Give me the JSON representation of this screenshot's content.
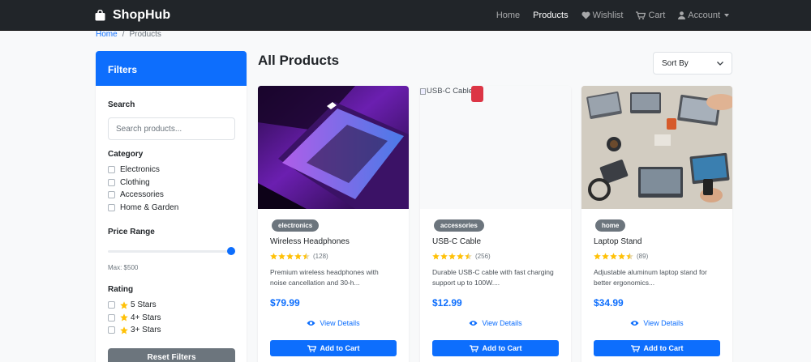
{
  "brand": {
    "name": "ShopHub"
  },
  "nav": {
    "home": "Home",
    "products": "Products",
    "wishlist": "Wishlist",
    "cart": "Cart",
    "account": "Account"
  },
  "breadcrumb": {
    "home": "Home",
    "current": "Products",
    "separator": "/"
  },
  "filters": {
    "title": "Filters",
    "search_label": "Search",
    "search_placeholder": "Search products...",
    "category_label": "Category",
    "categories": [
      "Electronics",
      "Clothing",
      "Accessories",
      "Home & Garden"
    ],
    "price_label": "Price Range",
    "price_max_label": "Max: $500",
    "price_slider_fraction": 1.0,
    "rating_label": "Rating",
    "ratings": [
      "5 Stars",
      "4+ Stars",
      "3+ Stars"
    ],
    "reset_label": "Reset Filters"
  },
  "main": {
    "title": "All Products",
    "sort_label": "Sort By"
  },
  "products": [
    {
      "badge": "electronics",
      "name": "Wireless Headphones",
      "rating": 4.5,
      "reviews": "(128)",
      "desc_line1": "Premium wireless headphones with",
      "desc_line2": "noise cancellation and 30-h...",
      "price": "$79.99",
      "view_label": "View Details",
      "cart_label": "Add to Cart",
      "image": "laptop-purple-light"
    },
    {
      "badge": "accessories",
      "name": "USB-C Cable",
      "rating": 4.5,
      "reviews": "(256)",
      "desc_line1": "Durable USB-C cable with fast charging",
      "desc_line2": "support up to 100W....",
      "price": "$12.99",
      "view_label": "View Details",
      "cart_label": "Add to Cart",
      "image_alt": "USB-C Cable"
    },
    {
      "badge": "home",
      "name": "Laptop Stand",
      "rating": 4.5,
      "reviews": "(89)",
      "desc_line1": "Adjustable aluminum laptop stand for",
      "desc_line2": "better ergonomics...",
      "price": "$34.99",
      "view_label": "View Details",
      "cart_label": "Add to Cart",
      "image": "desk-laptops-overhead"
    }
  ],
  "colors": {
    "primary": "#0d6efd",
    "navbar": "#212529",
    "star": "#ffc107",
    "badge": "#6c757d",
    "reset": "#6c757d"
  }
}
